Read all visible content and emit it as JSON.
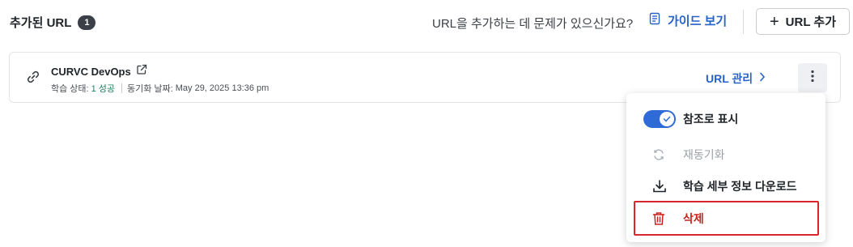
{
  "header": {
    "title": "추가된 URL",
    "count": "1",
    "help_text": "URL을 추가하는 데 문제가 있으신가요?",
    "guide_label": "가이드 보기",
    "add_url_label": "URL 추가"
  },
  "card": {
    "name": "CURVC DevOps",
    "status_label": "학습 상태:",
    "status_value": "1 성공",
    "sync_label": "동기화 날짜:",
    "sync_value": "May 29, 2025 13:36 pm",
    "manage_label": "URL 관리"
  },
  "menu": {
    "items": [
      {
        "label": "참조로 표시",
        "icon": "toggle-switch",
        "state": "on"
      },
      {
        "label": "재동기화",
        "icon": "sync-icon",
        "state": "disabled"
      },
      {
        "label": "학습 세부 정보 다운로드",
        "icon": "download-icon"
      },
      {
        "label": "삭제",
        "icon": "trash-icon",
        "style": "danger"
      }
    ]
  },
  "colors": {
    "accent": "#2563c9",
    "danger": "#c8231f",
    "success": "#1a7f5a",
    "toggle_on": "#2f6bd6",
    "highlight": "#d9262a"
  }
}
